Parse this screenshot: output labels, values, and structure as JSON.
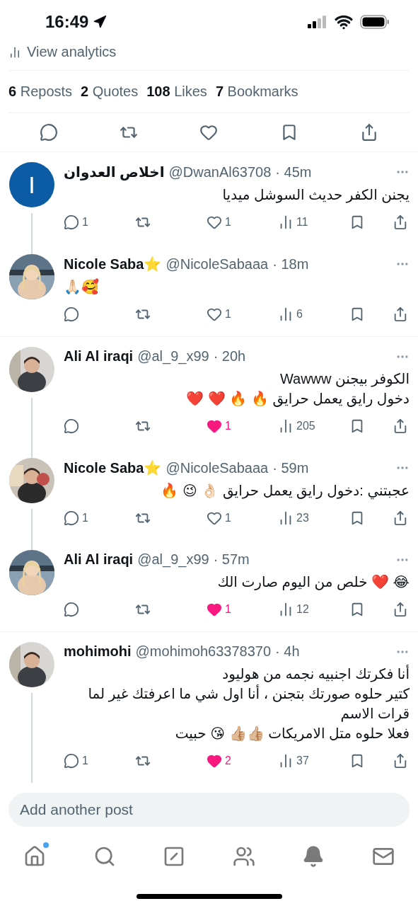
{
  "status_bar": {
    "time": "16:49"
  },
  "analytics": {
    "label": "View analytics"
  },
  "stats": [
    {
      "count": "6",
      "label": "Reposts"
    },
    {
      "count": "2",
      "label": "Quotes"
    },
    {
      "count": "108",
      "label": "Likes"
    },
    {
      "count": "7",
      "label": "Bookmarks"
    }
  ],
  "replies": [
    {
      "avatar": {
        "kind": "letter",
        "letter": "I",
        "color": "#0b5ca4"
      },
      "name": "اخلاص العدوان",
      "handle": "@DwanAl63708",
      "time": "· 45m",
      "text": "يجنن الكفر حديث السوشل ميديا",
      "replies": "1",
      "liked": false,
      "likes": "1",
      "views": "11",
      "thread_below": true
    },
    {
      "name": "Nicole Saba⭐️",
      "handle": "@NicoleSabaaa",
      "time": "· 18m",
      "text": "🙏🏻🥰",
      "liked": false,
      "likes": "1",
      "views": "6",
      "thread_below": false
    },
    {
      "name": "Ali Al iraqi",
      "handle": "@al_9_x99",
      "time": "· 20h",
      "text": "الكوفر بيجنن Wawww\nدخول رايق يعمل حرايق 🔥 🔥 ❤️ ❤️",
      "liked": true,
      "likes": "1",
      "views": "205",
      "thread_below": true
    },
    {
      "name": "Nicole Saba⭐️",
      "handle": "@NicoleSabaaa",
      "time": "· 59m",
      "text": "عجبتني :دخول رايق يعمل حرايق 👌🏻 😉 🔥",
      "replies": "1",
      "liked": false,
      "likes": "1",
      "views": "23",
      "thread_below": true
    },
    {
      "name": "Ali Al iraqi",
      "handle": "@al_9_x99",
      "time": "· 57m",
      "text": "😂 ❤️ خلص من اليوم صارت الك",
      "liked": true,
      "likes": "1",
      "views": "12",
      "thread_below": false
    },
    {
      "name": "mohimohi",
      "handle": "@mohimoh63378370",
      "time": "· 4h",
      "text": "أنا فكرتك اجنبيه نجمه من هوليود\nكتير حلوه صورتك بتجنن ، أنا اول شي ما اعرفتك غير لما قرات الاسم\nفعلا حلوه متل الامريكات 👍🏼👍🏼 😘 حبيت",
      "replies": "1",
      "liked": true,
      "likes": "2",
      "views": "37",
      "thread_below": true
    }
  ],
  "composer": {
    "placeholder": "Add another post"
  },
  "nav": [
    {
      "kind": "home",
      "badge": true
    },
    {
      "kind": "search",
      "badge": false
    },
    {
      "kind": "grok",
      "badge": false
    },
    {
      "kind": "communities",
      "badge": false
    },
    {
      "kind": "notifications",
      "badge": false
    },
    {
      "kind": "messages",
      "badge": false
    }
  ]
}
